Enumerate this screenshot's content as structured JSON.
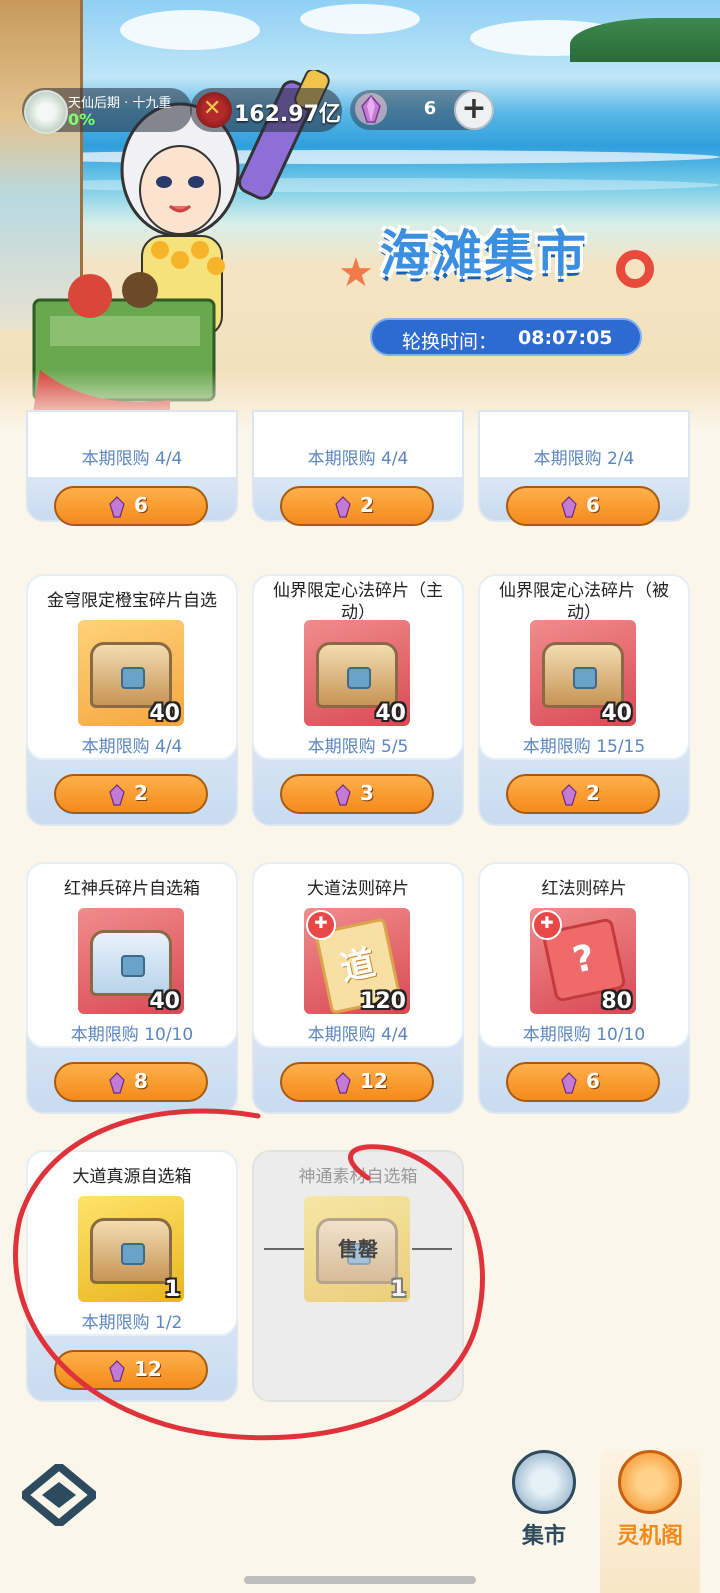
{
  "header": {
    "realm_name": "天仙后期 · 十九重",
    "realm_progress": "0%",
    "power": "162.97亿",
    "gem_count": "6",
    "add_label": "+",
    "title": "海滩集市",
    "rotation_label": "轮换时间：",
    "rotation_time": "08:07:05"
  },
  "top_row": [
    {
      "limit": "本期限购 4/4",
      "price": "6"
    },
    {
      "limit": "本期限购 4/4",
      "price": "2"
    },
    {
      "limit": "本期限购 2/4",
      "price": "6"
    }
  ],
  "items": [
    {
      "name": "金穹限定橙宝碎片自选",
      "count": "40",
      "limit": "本期限购 4/4",
      "price": "2"
    },
    {
      "name": "仙界限定心法碎片（主动）",
      "count": "40",
      "limit": "本期限购 5/5",
      "price": "3"
    },
    {
      "name": "仙界限定心法碎片（被动）",
      "count": "40",
      "limit": "本期限购 15/15",
      "price": "2"
    },
    {
      "name": "红神兵碎片自选箱",
      "count": "40",
      "limit": "本期限购 10/10",
      "price": "8"
    },
    {
      "name": "大道法则碎片",
      "count": "120",
      "limit": "本期限购 4/4",
      "price": "12",
      "glyph": "道"
    },
    {
      "name": "红法则碎片",
      "count": "80",
      "limit": "本期限购 10/10",
      "price": "6",
      "glyph": "?"
    },
    {
      "name": "大道真源自选箱",
      "count": "1",
      "limit": "本期限购 1/2",
      "price": "12"
    },
    {
      "name": "神通素材自选箱",
      "count": "1",
      "soldout": "售罄"
    }
  ],
  "nav": {
    "market": "集市",
    "lingji": "灵机阁"
  },
  "colors": {
    "accent_orange": "#f38a1c",
    "limit_blue": "#5b86c2",
    "annotation_red": "#e0323a",
    "nav_active": "#f08a1c"
  }
}
